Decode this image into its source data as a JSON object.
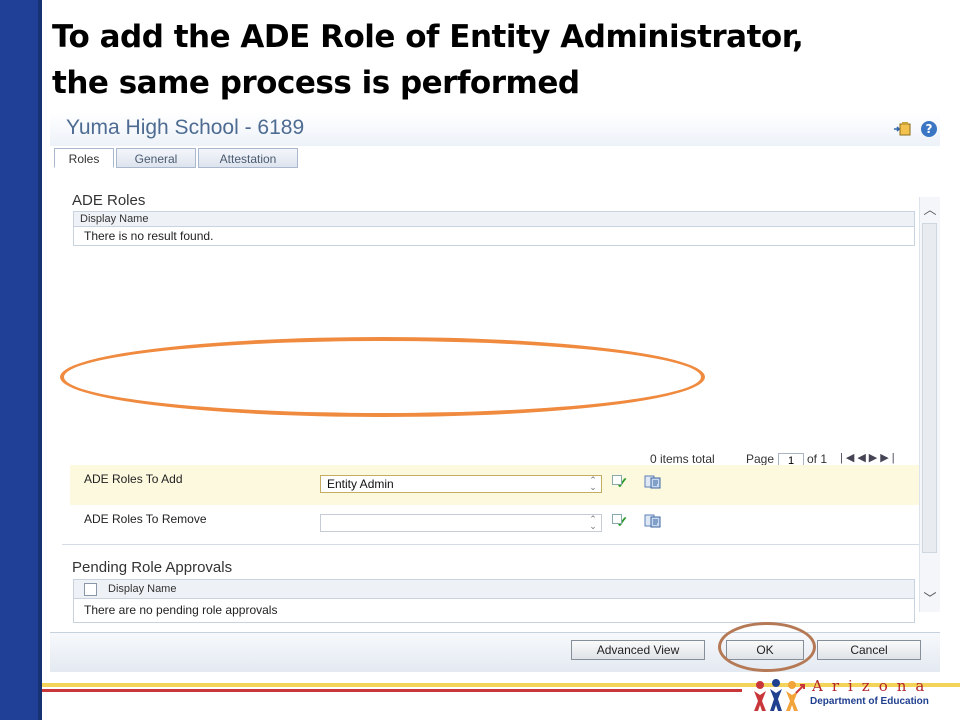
{
  "slide": {
    "title_line1": "To add the ADE Role of Entity Administrator,",
    "title_line2": "the same process is performed"
  },
  "window": {
    "title": "Yuma High School - 6189",
    "tabs": [
      {
        "label": "Roles",
        "active": true
      },
      {
        "label": "General",
        "active": false
      },
      {
        "label": "Attestation",
        "active": false
      }
    ]
  },
  "ade_roles": {
    "section_title": "ADE Roles",
    "column_header": "Display Name",
    "empty_message": "There is no result found.",
    "pager": {
      "items_total": "0 items total",
      "page_label": "Page",
      "page_value": "1",
      "of_label": "of 1"
    }
  },
  "roles_to_add": {
    "label": "ADE Roles To Add",
    "selected_value": "Entity Admin"
  },
  "roles_to_remove": {
    "label": "ADE Roles To Remove",
    "selected_value": ""
  },
  "pending": {
    "section_title": "Pending Role Approvals",
    "column_header": "Display Name",
    "empty_message": "There are no pending role approvals"
  },
  "footer": {
    "advanced_view_label": "Advanced View",
    "ok_label": "OK",
    "cancel_label": "Cancel"
  },
  "logo": {
    "name": "Arizona",
    "subtitle": "Department of Education"
  },
  "colors": {
    "left_bar": "#1f4096",
    "highlight_ellipse": "#ef8a3f",
    "ok_ellipse": "#b57a55",
    "logo_red": "#b32428",
    "logo_blue": "#1f3f8f"
  }
}
